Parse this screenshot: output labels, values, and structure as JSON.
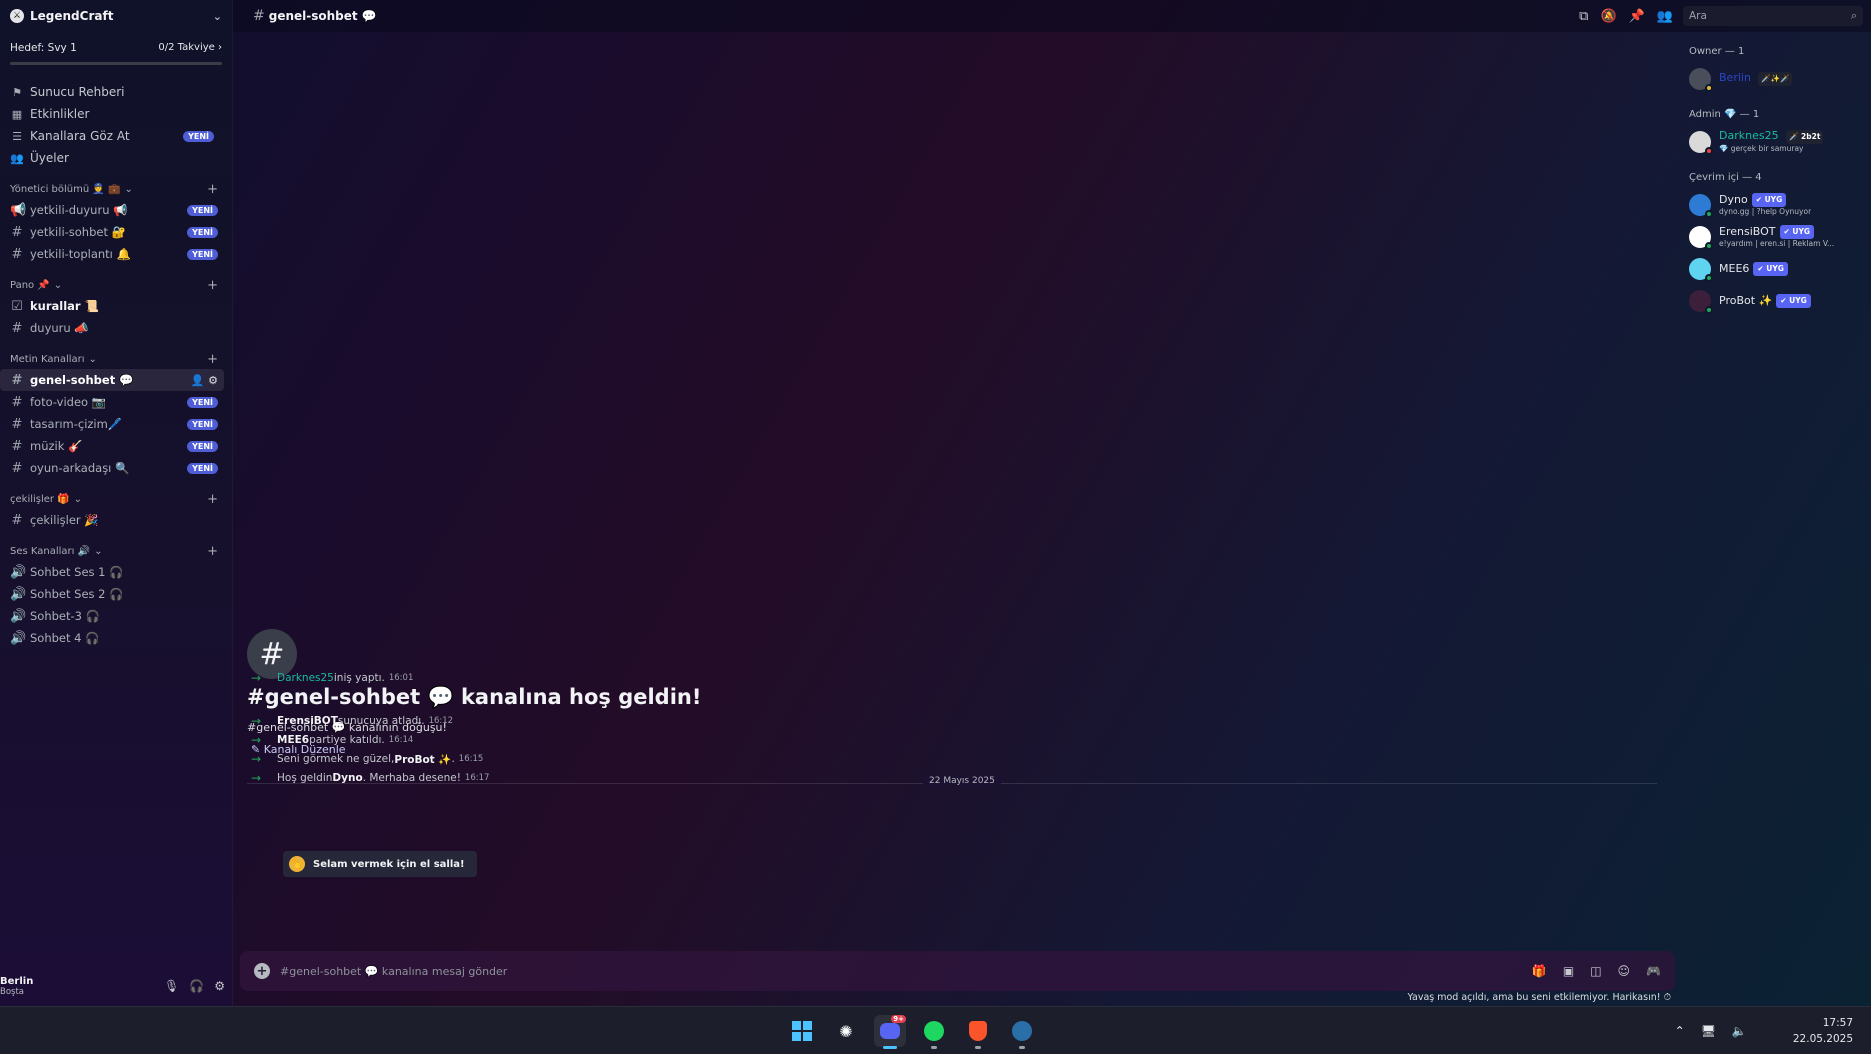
{
  "server": {
    "name": "LegendCraft"
  },
  "boost": {
    "goal": "Hedef: Svy 1",
    "progress": "0/2 Takviye",
    "progress_value": 0
  },
  "nav_items": [
    {
      "icon": "signpost-icon",
      "label": "Sunucu Rehberi",
      "badge": ""
    },
    {
      "icon": "calendar-icon",
      "label": "Etkinlikler",
      "badge": ""
    },
    {
      "icon": "browse-channels-icon",
      "label": "Kanallara Göz At",
      "badge": "YENİ"
    },
    {
      "icon": "members-icon",
      "label": "Üyeler",
      "badge": ""
    }
  ],
  "categories": [
    {
      "name": "Yönetici bölümü 👮 💼",
      "channels": [
        {
          "name": "yetkili-duyuru 📢",
          "badge": "YENİ",
          "icon": "announcement-icon"
        },
        {
          "name": "yetkili-sohbet 🔐",
          "badge": "YENİ",
          "icon": "hash-lock-icon"
        },
        {
          "name": "yetkili-toplantı 🔔",
          "badge": "YENİ",
          "icon": "hash-lock-icon"
        }
      ]
    },
    {
      "name": "Pano 📌",
      "channels": [
        {
          "name": "kurallar 📜",
          "badge": "",
          "icon": "rules-icon",
          "bold": true
        },
        {
          "name": "duyuru 📣",
          "badge": "",
          "icon": "hash-icon"
        }
      ]
    },
    {
      "name": "Metin Kanalları",
      "channels": [
        {
          "name": "genel-sohbet 💬",
          "badge": "",
          "icon": "hash-icon",
          "active": true
        },
        {
          "name": "foto-video 📷",
          "badge": "YENİ",
          "icon": "hash-icon"
        },
        {
          "name": "tasarım-çizim🖊️",
          "badge": "YENİ",
          "icon": "hash-icon"
        },
        {
          "name": "müzik 🎸",
          "badge": "YENİ",
          "icon": "hash-icon"
        },
        {
          "name": "oyun-arkadaşı 🔍",
          "badge": "YENİ",
          "icon": "hash-icon"
        }
      ]
    },
    {
      "name": "çekilişler 🎁",
      "channels": [
        {
          "name": "çekilişler 🎉",
          "badge": "",
          "icon": "hash-icon"
        }
      ]
    },
    {
      "name": "Ses Kanalları 🔊",
      "channels": [
        {
          "name": "Sohbet Ses 1 🎧",
          "badge": "",
          "icon": "speaker-icon"
        },
        {
          "name": "Sohbet Ses 2 🎧",
          "badge": "",
          "icon": "speaker-icon"
        },
        {
          "name": "Sohbet-3 🎧",
          "badge": "",
          "icon": "speaker-icon"
        },
        {
          "name": "Sohbet 4 🎧",
          "badge": "",
          "icon": "speaker-icon"
        }
      ]
    }
  ],
  "user": {
    "name": "Berlin",
    "status": "Boşta"
  },
  "topbar": {
    "channel": "genel-sohbet 💬",
    "search_placeholder": "Ara"
  },
  "welcome": {
    "title": "#genel-sohbet 💬 kanalına hoş geldin!",
    "subtitle": "#genel-sohbet 💬 kanalının doğuşu!",
    "edit": "Kanalı Düzenle"
  },
  "date_divider": "22 Mayıs 2025",
  "messages": [
    {
      "pre": "",
      "user": "Darknes25",
      "post": " iniş yaptı.",
      "time": "16:01",
      "teal": true
    },
    {
      "pre": "",
      "user": "ErensiBOT",
      "post": " sunucuya atladı.",
      "time": "16:12"
    },
    {
      "pre": "",
      "user": "MEE6",
      "post": " partiye katıldı.",
      "time": "16:14"
    },
    {
      "pre": "Seni görmek ne güzel, ",
      "user": "ProBot ✨",
      "post": ".",
      "time": "16:15"
    },
    {
      "pre": "Hoş geldin ",
      "user": "Dyno",
      "post": ". Merhaba desene!",
      "time": "16:17"
    }
  ],
  "wave_button": "Selam vermek için el salla!",
  "composer": {
    "placeholder": "#genel-sohbet 💬 kanalına mesaj gönder"
  },
  "slowmode": "Yavaş mod açıldı, ama bu seni etkilemiyor. Harikasın!",
  "members": {
    "owner_header": "Owner — 1",
    "admin_header": "Admin 💎 — 1",
    "online_header": "Çevrim içi — 4",
    "owner": {
      "name": "Berlin",
      "tag": "🗡️✨🗡️"
    },
    "admin": {
      "name": "Darknes25",
      "tag": "🗡️ 2b2t",
      "sub": "💎 gerçek bir samuray"
    },
    "online": [
      {
        "name": "Dyno",
        "badge": "✔ UYG",
        "sub": "dyno.gg | ?help Oynuyor",
        "color": "#2e7bd6"
      },
      {
        "name": "ErensiBOT",
        "badge": "✔ UYG",
        "sub": "e!yardım | eren.si | Reklam V...",
        "color": "#ffffff"
      },
      {
        "name": "MEE6",
        "badge": "✔ UYG",
        "sub": "",
        "color": "#5fd3f0"
      },
      {
        "name": "ProBot ✨",
        "badge": "✔ UYG",
        "sub": "",
        "color": "#3b1f3b"
      }
    ]
  },
  "taskbar": {
    "time": "17:57",
    "date": "22.05.2025",
    "discord_notif": "9+"
  },
  "colors": {
    "accent": "#5865f2",
    "online": "#23a55a",
    "teal_name": "#1abc9c"
  }
}
